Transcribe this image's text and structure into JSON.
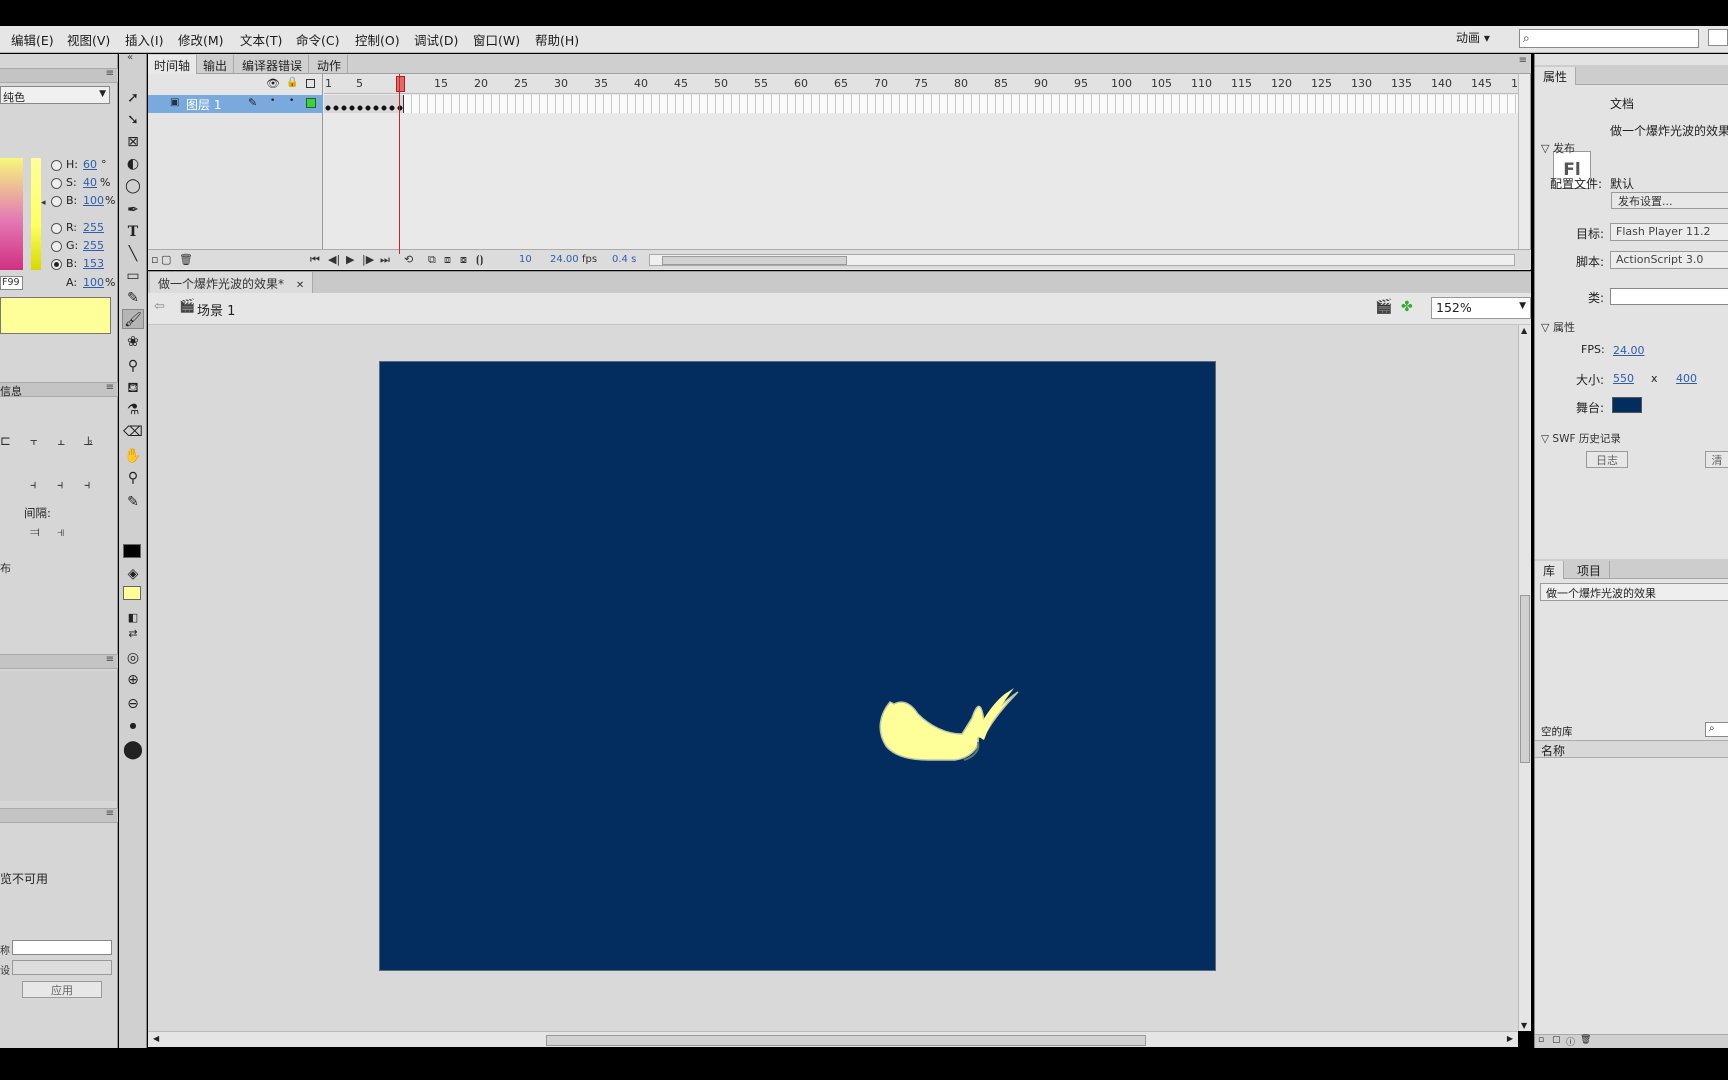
{
  "menubar": {
    "items": [
      "编辑(E)",
      "视图(V)",
      "插入(I)",
      "修改(M)",
      "文本(T)",
      "命令(C)",
      "控制(O)",
      "调试(D)",
      "窗口(W)",
      "帮助(H)"
    ],
    "workspace": "动画",
    "search_placeholder": ""
  },
  "left_panel": {
    "color_type": "纯色",
    "hsb": {
      "h_label": "H:",
      "h_value": "60",
      "h_unit": "°",
      "s_label": "S:",
      "s_value": "40",
      "s_unit": "%",
      "b_label": "B:",
      "b_value": "100",
      "b_unit": "%"
    },
    "rgb": {
      "r_label": "R:",
      "r_value": "255",
      "g_label": "G:",
      "g_value": "255",
      "b_label": "B:",
      "b_value": "153",
      "a_label": "A:",
      "a_value": "100",
      "a_unit": "%"
    },
    "hex_value": "F99",
    "swatch_color": "#ffff99",
    "align_panel_title": "信息",
    "spacing_label": "间隔:",
    "panel_char": "布",
    "unavailable_text": "览不可用",
    "apply_button": "应用",
    "field_label_1": "称",
    "field_label_2": "设"
  },
  "timeline": {
    "tabs": [
      "时间轴",
      "输出",
      "编译器错误",
      "动作"
    ],
    "layer_name": "图层 1",
    "frame_numbers": [
      "1",
      "5",
      "15",
      "20",
      "25",
      "30",
      "35",
      "40",
      "45",
      "50",
      "55",
      "60",
      "65",
      "70",
      "75",
      "80",
      "85",
      "90",
      "95",
      "100",
      "105",
      "110",
      "115",
      "120",
      "125",
      "130",
      "135",
      "140",
      "145",
      "1"
    ],
    "current_frame": "10",
    "fps": "24.00",
    "fps_unit": "fps",
    "elapsed": "0.4 s"
  },
  "document": {
    "tab_title": "做一个爆炸光波的效果*",
    "scene": "场景 1",
    "zoom": "152%",
    "stage_color": "#022d5e",
    "shape_color": "#ffff99"
  },
  "properties": {
    "tab": "属性",
    "doc_type": "文档",
    "doc_name": "做一个爆炸光波的效果",
    "publish_section": "发布",
    "profile_label": "配置文件:",
    "profile_value": "默认",
    "publish_settings_button": "发布设置...",
    "target_label": "目标:",
    "target_value": "Flash Player 11.2",
    "script_label": "脚本:",
    "script_value": "ActionScript 3.0",
    "class_label": "类:",
    "props_section": "属性",
    "fps_label": "FPS:",
    "fps_value": "24.00",
    "size_label": "大小:",
    "width": "550",
    "x_char": "x",
    "height": "400",
    "stage_label": "舞台:",
    "swf_section": "SWF 历史记录",
    "log_button": "日志",
    "clear_button": "清"
  },
  "library": {
    "tabs": [
      "库",
      "项目"
    ],
    "current": "做一个爆炸光波的效果",
    "empty_label": "空的库",
    "name_column": "名称"
  }
}
